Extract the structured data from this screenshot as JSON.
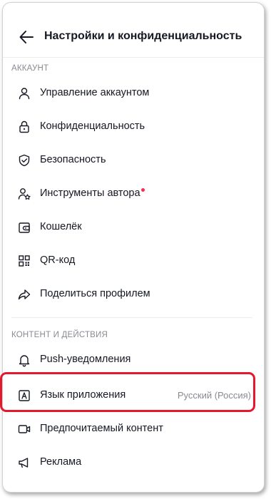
{
  "header": {
    "title": "Настройки и конфиденциальность"
  },
  "sections": [
    {
      "label": "АККАУНТ",
      "items": [
        {
          "label": "Управление аккаунтом",
          "icon": "user-icon"
        },
        {
          "label": "Конфиденциальность",
          "icon": "lock-icon"
        },
        {
          "label": "Безопасность",
          "icon": "shield-icon"
        },
        {
          "label": "Инструменты автора",
          "icon": "creator-tools-icon"
        },
        {
          "label": "Кошелёк",
          "icon": "wallet-icon"
        },
        {
          "label": "QR-код",
          "icon": "qr-code-icon"
        },
        {
          "label": "Поделиться профилем",
          "icon": "share-icon"
        }
      ]
    },
    {
      "label": "КОНТЕНТ И ДЕЙСТВИЯ",
      "items": [
        {
          "label": "Push-уведомления",
          "icon": "bell-icon"
        },
        {
          "label": "Язык приложения",
          "value": "Русский (Россия)",
          "icon": "language-icon"
        },
        {
          "label": "Предпочитаемый контент",
          "icon": "video-camera-icon"
        },
        {
          "label": "Реклама",
          "icon": "megaphone-icon"
        }
      ]
    }
  ],
  "colors": {
    "notification_dot": "#fe2c55",
    "highlight": "#e5182d",
    "muted_text": "#8a8b91"
  }
}
